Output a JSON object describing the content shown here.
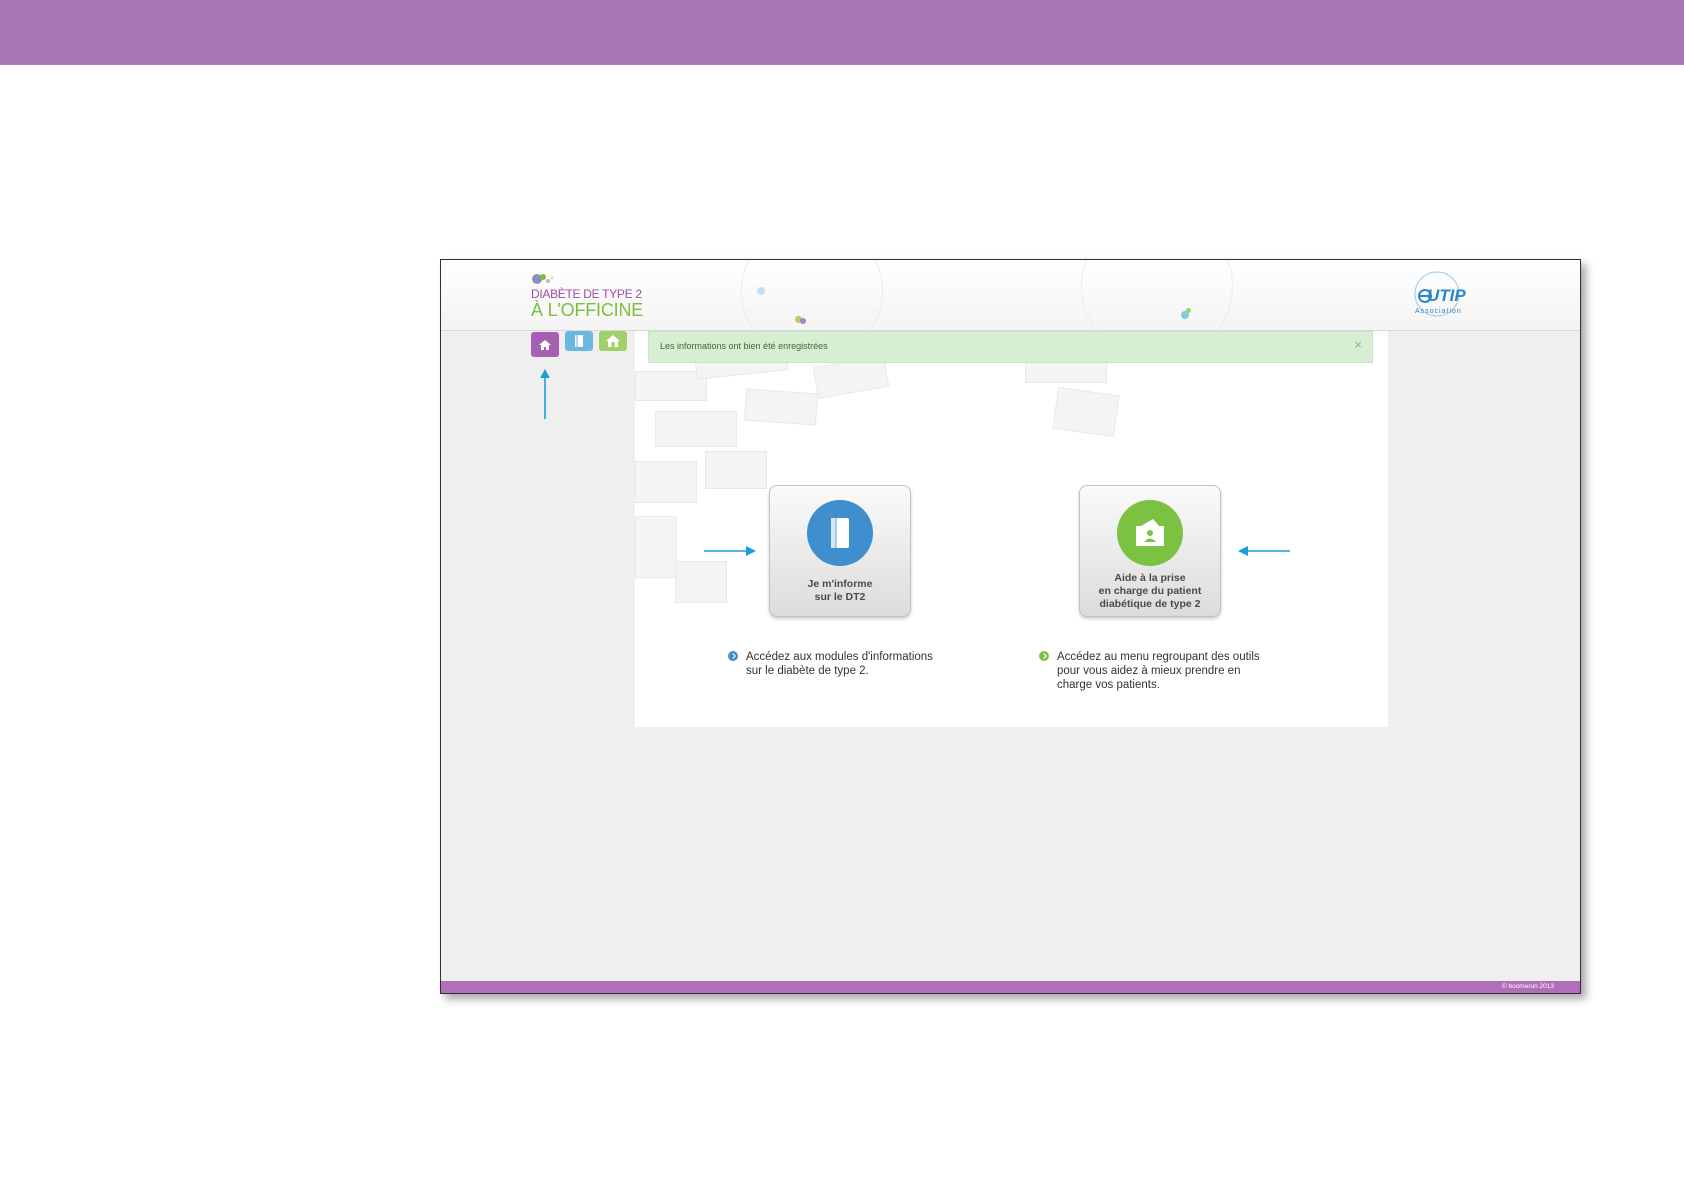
{
  "app": {
    "logo": {
      "line1": "DIABÈTE DE TYPE 2",
      "line2": "À L'OFFICINE"
    },
    "partner_logo": {
      "name": "UTIP",
      "subtitle": "Association"
    }
  },
  "nav": {
    "items": [
      {
        "id": "home",
        "icon": "home-icon",
        "color": "#a65fb3"
      },
      {
        "id": "info",
        "icon": "book-icon",
        "color": "#6bb7e0"
      },
      {
        "id": "tools",
        "icon": "house-tools-icon",
        "color": "#9fd06a"
      }
    ]
  },
  "alert": {
    "text": "Les informations ont bien été enregistrées",
    "close": "×"
  },
  "tiles": {
    "info": {
      "label_line1": "Je m'informe",
      "label_line2": "sur le DT2",
      "icon": "book-icon",
      "color": "#3f8fcf"
    },
    "tools": {
      "label_line1": "Aide à la prise",
      "label_line2": "en charge du patient",
      "label_line3": "diabétique de type 2",
      "icon": "patient-card-icon",
      "color": "#7cc242"
    }
  },
  "descriptions": {
    "info": {
      "line1": "Accédez aux modules d'informations",
      "line2": "sur le diabète de type 2."
    },
    "tools": {
      "line1": "Accédez au menu regroupant des outils",
      "line2": "pour vous aidez à mieux prendre en",
      "line3": "charge vos patients."
    }
  },
  "footer": {
    "copyright": "© boomerun 2013"
  },
  "colors": {
    "brand_purple": "#a877b3",
    "footer_purple": "#b06fb8",
    "annotation_arrow": "#1a9fd8"
  }
}
